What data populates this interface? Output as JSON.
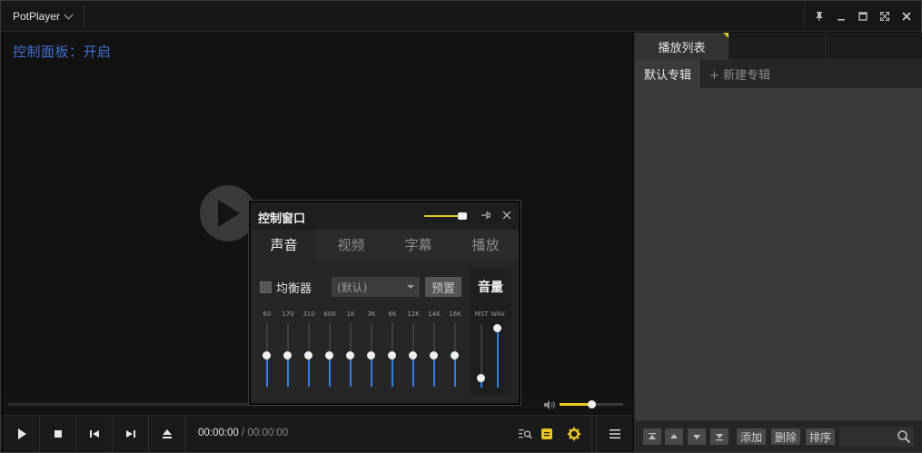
{
  "app": {
    "name": "PotPlayer"
  },
  "osd": {
    "text": "控制面板：开启"
  },
  "time": {
    "current": "00:00:00",
    "separator": "/",
    "total": "00:00:00"
  },
  "volume": {
    "level": 0.5
  },
  "playlist": {
    "tab_label": "播放列表",
    "albums": {
      "default": "默认专辑",
      "new": "+ 新建专辑"
    },
    "buttons": {
      "add": "添加",
      "delete": "删除",
      "sort": "排序"
    }
  },
  "control_window": {
    "title": "控制窗口",
    "tabs": [
      "声音",
      "视频",
      "字幕",
      "播放"
    ],
    "active_tab": 0,
    "equalizer": {
      "label": "均衡器",
      "checked": false,
      "preset": "(默认)",
      "preset_button": "预置",
      "bands": [
        {
          "label": "60",
          "level": 0.0
        },
        {
          "label": "170",
          "level": 0.0
        },
        {
          "label": "310",
          "level": 0.0
        },
        {
          "label": "600",
          "level": 0.0
        },
        {
          "label": "1K",
          "level": 0.0
        },
        {
          "label": "3K",
          "level": 0.0
        },
        {
          "label": "6K",
          "level": 0.0
        },
        {
          "label": "12K",
          "level": 0.0
        },
        {
          "label": "14K",
          "level": 0.0
        },
        {
          "label": "16K",
          "level": 0.0
        }
      ]
    },
    "volume": {
      "title": "音量",
      "channels": [
        {
          "label": "MST",
          "level": 0.1
        },
        {
          "label": "WAV",
          "level": 1.0
        }
      ]
    }
  },
  "colors": {
    "accent": "#e8c61e",
    "slider_fill": "#2f7fe6",
    "osd_text": "#3f6fd6"
  }
}
